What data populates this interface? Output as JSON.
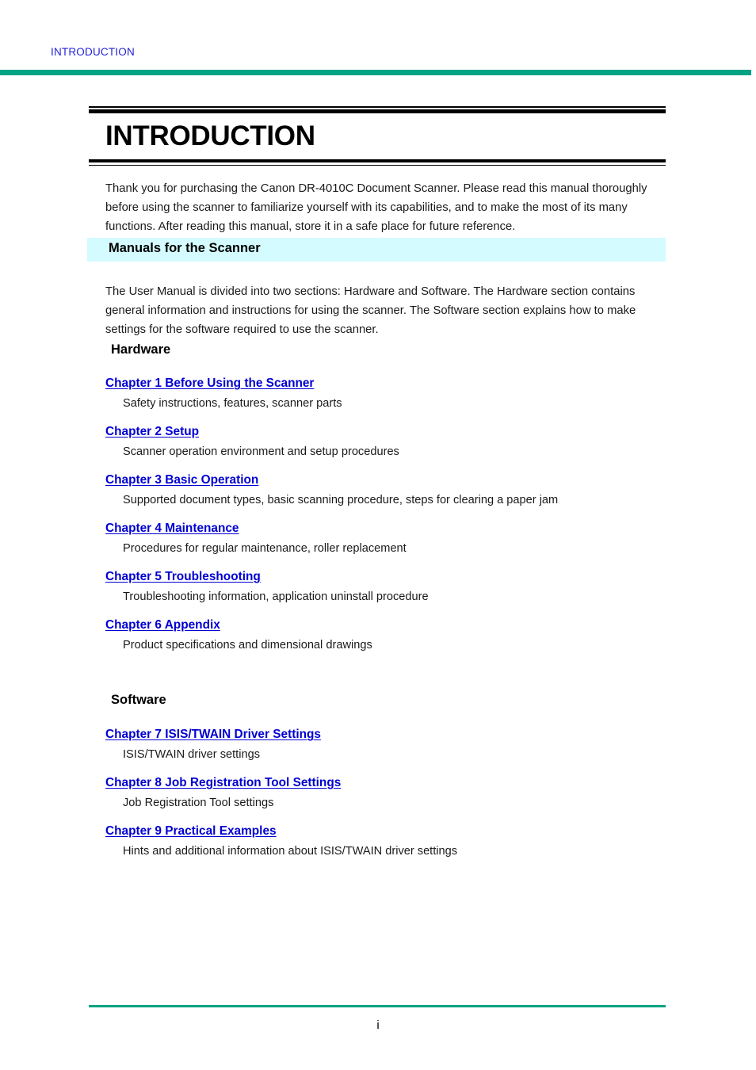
{
  "header": {
    "running_head": "INTRODUCTION",
    "rule_color": "#00a383"
  },
  "title_block": {
    "title": "INTRODUCTION"
  },
  "intro": {
    "paragraph": "Thank you for purchasing the Canon DR-4010C Document Scanner. Please read this manual thoroughly before using the scanner to familiarize yourself with its capabilities, and to make the most of its many functions. After reading this manual, store it in a safe place for future reference."
  },
  "manuals_section": {
    "band_label": "Manuals for the Scanner",
    "band_color": "#d4fbff",
    "paragraph": "The User Manual is divided into two sections: Hardware and Software. The Hardware section contains general information and instructions for using the scanner. The Software section explains how to make settings for the software required to use the scanner."
  },
  "hardware": {
    "heading": "Hardware",
    "chapters": [
      {
        "link": "Chapter 1   Before Using the Scanner",
        "description": "Safety instructions, features, scanner parts"
      },
      {
        "link": "Chapter 2   Setup",
        "description": "Scanner operation environment and setup procedures"
      },
      {
        "link": "Chapter 3   Basic Operation",
        "description": "Supported document types, basic scanning procedure, steps for clearing a paper jam"
      },
      {
        "link": "Chapter 4   Maintenance",
        "description": "Procedures for regular maintenance, roller replacement"
      },
      {
        "link": "Chapter 5   Troubleshooting",
        "description": "Troubleshooting information, application uninstall procedure"
      },
      {
        "link": "Chapter 6   Appendix",
        "description": "Product specifications and dimensional drawings"
      }
    ]
  },
  "software": {
    "heading": "Software",
    "chapters": [
      {
        "link": "Chapter 7   ISIS/TWAIN Driver Settings",
        "description": "ISIS/TWAIN driver settings"
      },
      {
        "link": "Chapter 8   Job Registration Tool Settings",
        "description": "Job Registration Tool settings"
      },
      {
        "link": "Chapter 9   Practical Examples",
        "description": "Hints and additional information about ISIS/TWAIN driver settings"
      }
    ]
  },
  "footer": {
    "page_number": "i",
    "rule_color": "#00a383"
  },
  "colors": {
    "link": "#0000d2",
    "running_head": "#2323d8",
    "accent_green": "#00a383",
    "band_cyan": "#d4fbff"
  }
}
